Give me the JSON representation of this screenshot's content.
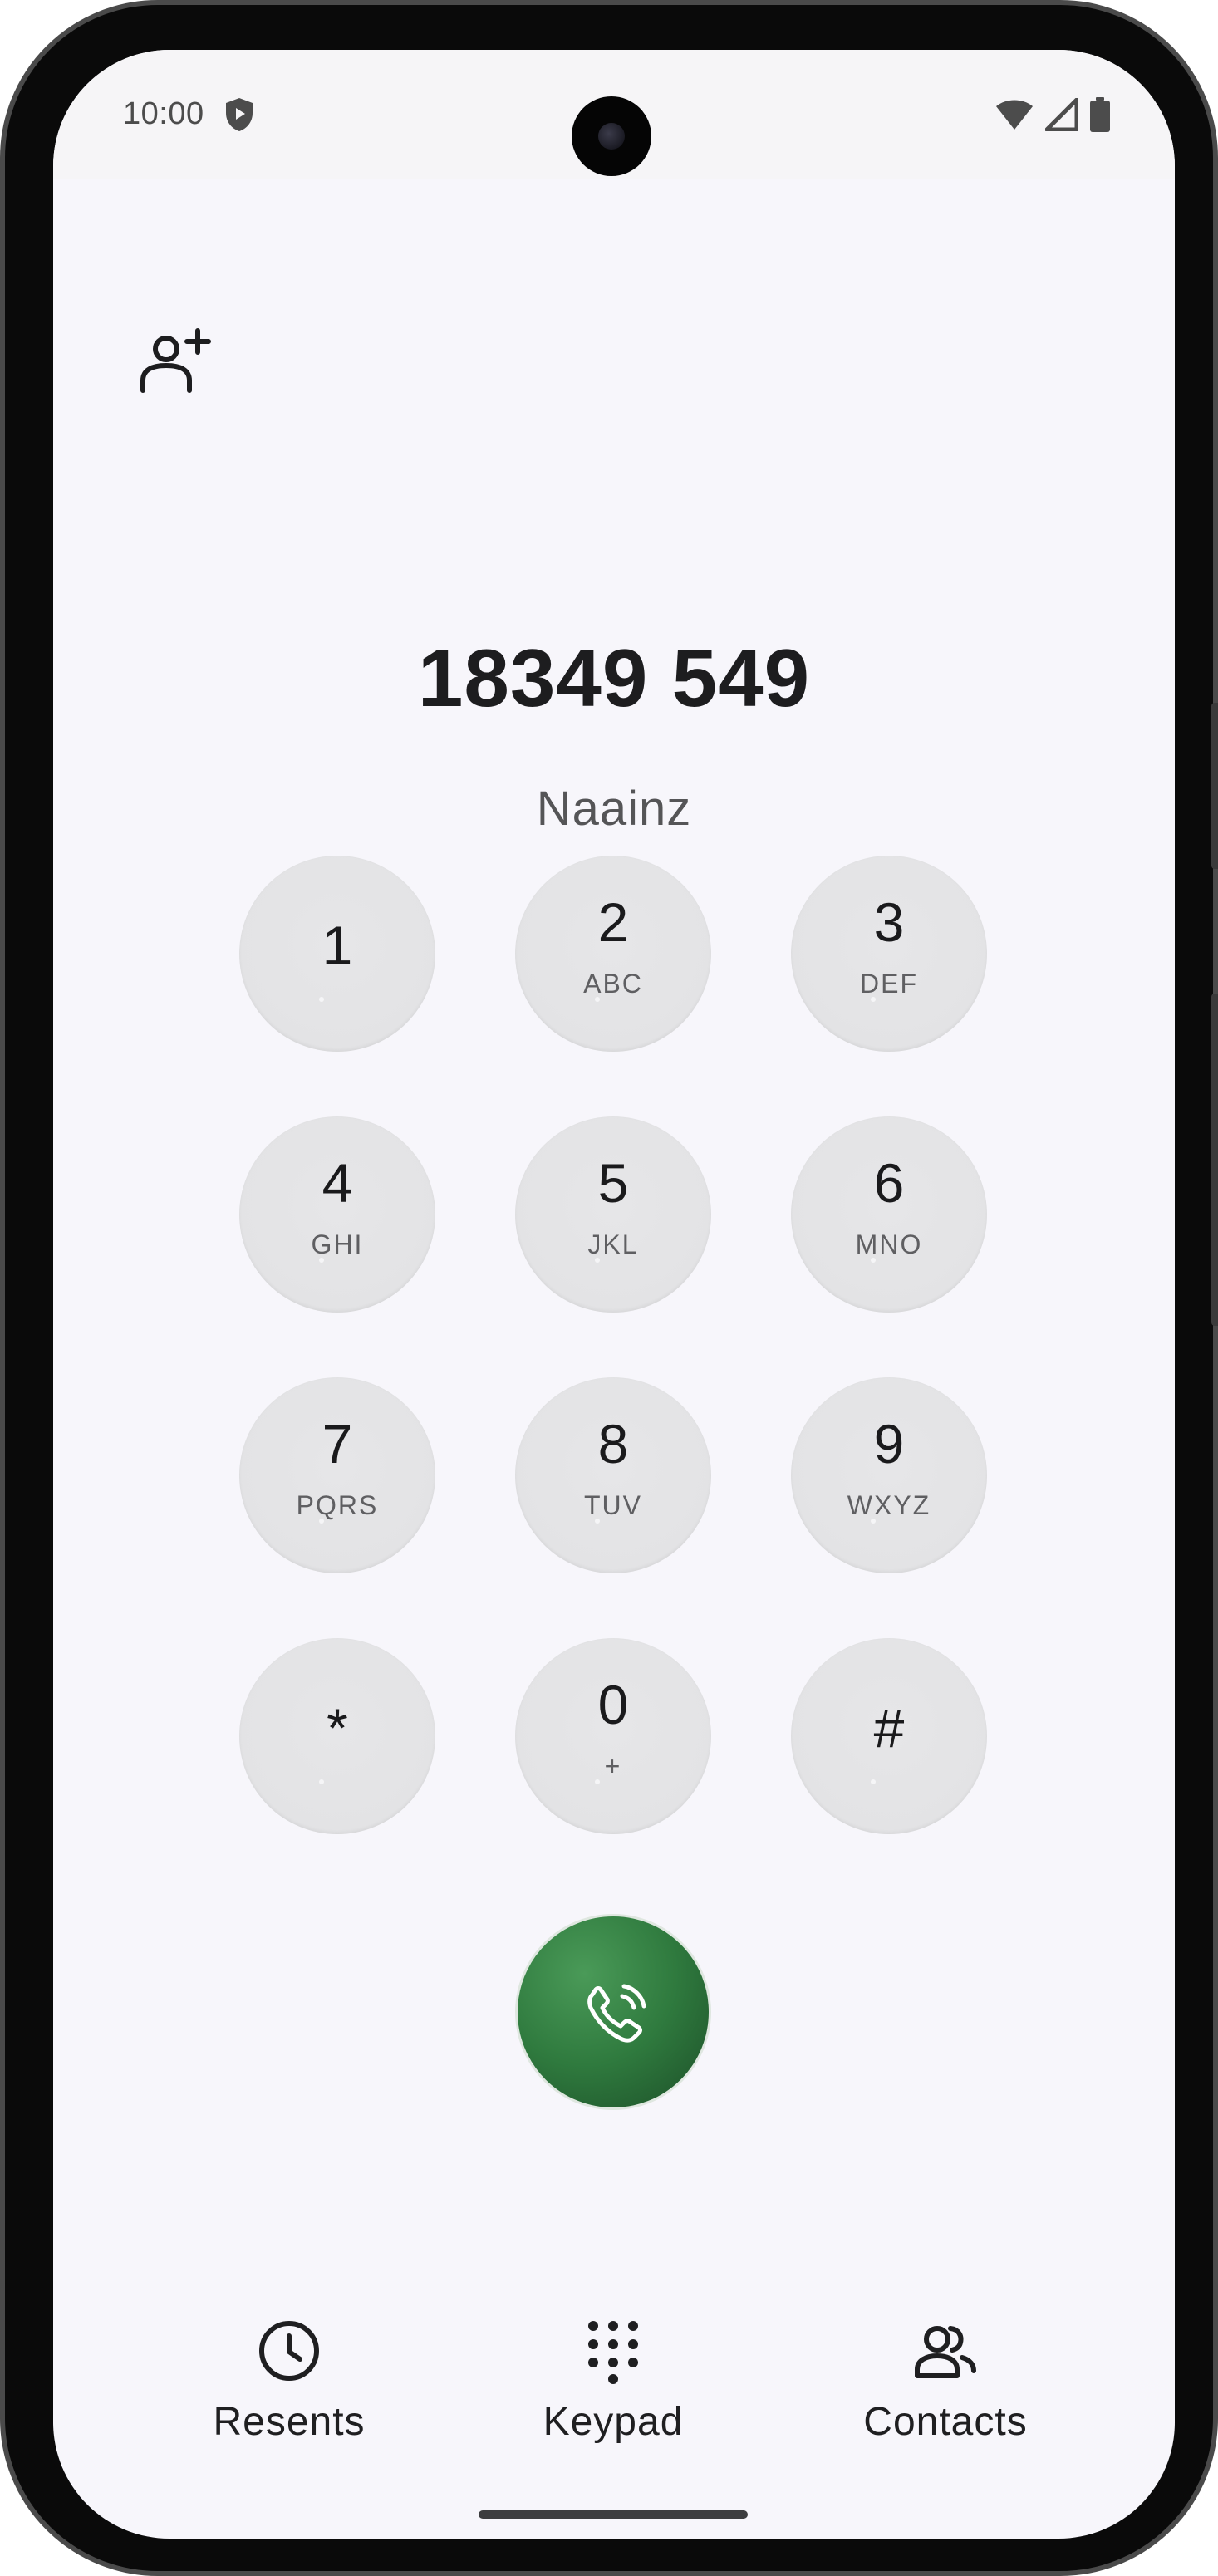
{
  "status_bar": {
    "time": "10:00",
    "icons": [
      "shield-play-icon",
      "wifi-icon",
      "cellular-signal-icon",
      "battery-icon"
    ]
  },
  "header": {
    "add_contact_icon": "person-add-icon"
  },
  "dialer": {
    "number": "18349 549",
    "contact_name": "Naainz"
  },
  "keypad": {
    "keys": [
      {
        "digit": "1",
        "letters": ""
      },
      {
        "digit": "2",
        "letters": "ABC"
      },
      {
        "digit": "3",
        "letters": "DEF"
      },
      {
        "digit": "4",
        "letters": "GHI"
      },
      {
        "digit": "5",
        "letters": "JKL"
      },
      {
        "digit": "6",
        "letters": "MNO"
      },
      {
        "digit": "7",
        "letters": "PQRS"
      },
      {
        "digit": "8",
        "letters": "TUV"
      },
      {
        "digit": "9",
        "letters": "WXYZ"
      },
      {
        "digit": "*",
        "letters": ""
      },
      {
        "digit": "0",
        "letters": "+"
      },
      {
        "digit": "#",
        "letters": ""
      }
    ]
  },
  "call_button": {
    "icon": "phone-call-icon",
    "color": "#2f7a3e"
  },
  "bottom_nav": {
    "items": [
      {
        "label": "Resents",
        "icon": "clock-icon"
      },
      {
        "label": "Keypad",
        "icon": "dialpad-icon"
      },
      {
        "label": "Contacts",
        "icon": "contacts-icon"
      }
    ]
  }
}
